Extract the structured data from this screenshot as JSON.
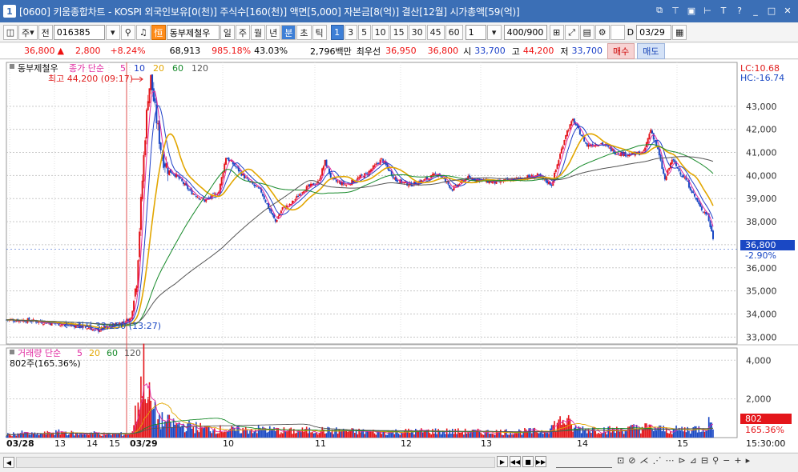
{
  "window": {
    "title": "[0600] 키움종합차트 - KOSPI 외국인보유[0(천)] 주식수[160(천)] 액면[5,000] 자본금[8(억)] 결산[12월] 시가총액[59(억)]",
    "tab_number": "1"
  },
  "toolbar": {
    "period_type": "주",
    "prev": "전",
    "code": "016385",
    "stock_name": "동부제철우",
    "tf_day": "일",
    "tf_week": "주",
    "tf_month": "월",
    "tf_year": "년",
    "tf_min": "분",
    "tf_sec": "초",
    "tf_tick": "틱",
    "minutes": [
      "1",
      "3",
      "5",
      "10",
      "15",
      "30",
      "45",
      "60"
    ],
    "selected_minute": "1",
    "custom_min": "1",
    "count": "400/900",
    "date_label": "D",
    "date": "03/29"
  },
  "quote": {
    "price": "36,800",
    "change_sign": "▲",
    "change": "2,800",
    "change_pct": "+8.24%",
    "volume": "68,913",
    "vol_ratio": "985.18%",
    "vol_pct2": "43.03%",
    "amount": "2,796백만",
    "bid_label": "최우선",
    "bid": "36,950",
    "ask": "36,800",
    "open_label": "시",
    "open": "33,700",
    "high_label": "고",
    "high": "44,200",
    "low_label": "저",
    "low": "33,700",
    "buy": "매수",
    "sell": "매도"
  },
  "chart_data": {
    "type": "candlestick",
    "legend": {
      "name": "동부제철우",
      "price_label": "종가 단순",
      "ma": [
        "5",
        "10",
        "20",
        "60",
        "120"
      ]
    },
    "ma_colors": {
      "5": "#e02aa0",
      "10": "#1e40c8",
      "20": "#e2a600",
      "60": "#178a2a",
      "120": "#555555"
    },
    "lc": "LC:10.68",
    "hc": "HC:-16.74",
    "high_annot": "최고 44,200 (09:17)",
    "low_annot": "최저 33,250 (13:27)",
    "current": "36,800",
    "current_pct": "-2.90%",
    "y_ticks": [
      "43,000",
      "42,000",
      "41,000",
      "40,000",
      "39,000",
      "38,000",
      "37,000",
      "36,000",
      "35,000",
      "34,000",
      "33,000"
    ],
    "ylim": [
      32700,
      44900
    ],
    "x_ticks": [
      "03/28",
      "13",
      "14",
      "15",
      "03/29",
      "10",
      "11",
      "12",
      "13",
      "14",
      "15"
    ],
    "time_axis_label": "15:30:00",
    "volume": {
      "legend": "거래량 단순",
      "ma": [
        "5",
        "20",
        "60",
        "120"
      ],
      "current": "802주(165.36%)",
      "y_ticks": [
        "4,000",
        "2,000"
      ],
      "ylim": [
        0,
        4300
      ],
      "tag_value": "802",
      "tag_pct": "165.36%"
    },
    "price_path": [
      [
        0,
        33750
      ],
      [
        15,
        33720
      ],
      [
        30,
        33620
      ],
      [
        50,
        33500
      ],
      [
        60,
        33370
      ],
      [
        62,
        33250
      ],
      [
        70,
        33400
      ],
      [
        80,
        33600
      ],
      [
        88,
        33800
      ],
      [
        92,
        35500
      ],
      [
        95,
        38800
      ],
      [
        98,
        41800
      ],
      [
        100,
        43500
      ],
      [
        102,
        44200
      ],
      [
        105,
        42800
      ],
      [
        110,
        40800
      ],
      [
        115,
        40200
      ],
      [
        120,
        40000
      ],
      [
        130,
        39300
      ],
      [
        140,
        38900
      ],
      [
        150,
        39300
      ],
      [
        155,
        40800
      ],
      [
        160,
        40500
      ],
      [
        170,
        39800
      ],
      [
        180,
        39300
      ],
      [
        185,
        38600
      ],
      [
        190,
        38000
      ],
      [
        195,
        38600
      ],
      [
        200,
        38700
      ],
      [
        210,
        39400
      ],
      [
        220,
        39700
      ],
      [
        225,
        40600
      ],
      [
        230,
        39800
      ],
      [
        240,
        39600
      ],
      [
        255,
        40100
      ],
      [
        265,
        40700
      ],
      [
        275,
        39800
      ],
      [
        285,
        39600
      ],
      [
        295,
        39800
      ],
      [
        305,
        40100
      ],
      [
        315,
        39400
      ],
      [
        325,
        39900
      ],
      [
        335,
        39800
      ],
      [
        345,
        39700
      ],
      [
        355,
        39800
      ],
      [
        365,
        39900
      ],
      [
        375,
        40000
      ],
      [
        385,
        39600
      ],
      [
        390,
        40700
      ],
      [
        395,
        41800
      ],
      [
        400,
        42400
      ],
      [
        410,
        41300
      ],
      [
        420,
        41400
      ],
      [
        430,
        41000
      ],
      [
        440,
        40900
      ],
      [
        450,
        41000
      ],
      [
        455,
        42000
      ],
      [
        460,
        41100
      ],
      [
        465,
        39800
      ],
      [
        470,
        40700
      ],
      [
        475,
        40200
      ],
      [
        480,
        39800
      ],
      [
        485,
        39200
      ],
      [
        490,
        38600
      ],
      [
        495,
        38300
      ],
      [
        499,
        37300
      ]
    ],
    "volume_path": [
      [
        0,
        150
      ],
      [
        10,
        250
      ],
      [
        20,
        180
      ],
      [
        40,
        300
      ],
      [
        50,
        200
      ],
      [
        60,
        250
      ],
      [
        70,
        180
      ],
      [
        88,
        200
      ],
      [
        92,
        1500
      ],
      [
        94,
        2600
      ],
      [
        96,
        3200
      ],
      [
        98,
        4000
      ],
      [
        100,
        2200
      ],
      [
        103,
        1600
      ],
      [
        106,
        1100
      ],
      [
        110,
        900
      ],
      [
        120,
        700
      ],
      [
        140,
        500
      ],
      [
        160,
        400
      ],
      [
        180,
        450
      ],
      [
        200,
        350
      ],
      [
        220,
        400
      ],
      [
        240,
        350
      ],
      [
        260,
        300
      ],
      [
        300,
        350
      ],
      [
        340,
        300
      ],
      [
        380,
        350
      ],
      [
        394,
        1000
      ],
      [
        397,
        800
      ],
      [
        400,
        500
      ],
      [
        430,
        400
      ],
      [
        450,
        550
      ],
      [
        470,
        400
      ],
      [
        490,
        500
      ],
      [
        499,
        900
      ]
    ]
  },
  "scrollbar": {
    "controls": [
      "▶",
      "◀◀",
      "■",
      "▶▶"
    ]
  }
}
